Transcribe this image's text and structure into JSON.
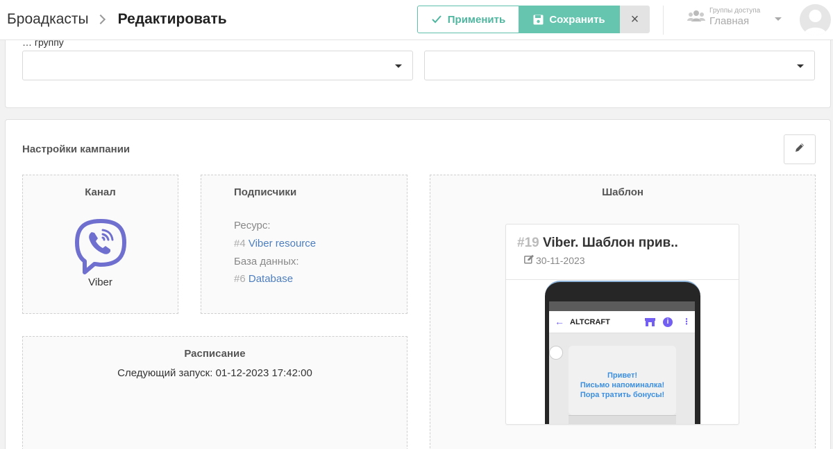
{
  "header": {
    "breadcrumb_parent": "Броадкасты",
    "breadcrumb_current": "Редактировать",
    "apply_label": "Применить",
    "save_label": "Сохранить",
    "close_label": "×",
    "access_caption": "Группы доступа",
    "access_value": "Главная"
  },
  "top_card": {
    "partial_label": "… группу"
  },
  "campaign": {
    "title": "Настройки кампании",
    "channel": {
      "title": "Канал",
      "name": "Viber"
    },
    "subscribers": {
      "title": "Подписчики",
      "resource_label": "Ресурс:",
      "resource_num": "#4",
      "resource_name": "Viber resource",
      "database_label": "База данных:",
      "database_num": "#6",
      "database_name": "Database"
    },
    "schedule": {
      "title": "Расписание",
      "next_run": "Следующий запуск: 01-12-2023 17:42:00"
    },
    "template": {
      "title": "Шаблон",
      "num": "#19",
      "name": "Viber. Шаблон прив..",
      "date": "30-11-2023",
      "preview": {
        "sender": "ALTCRAFT",
        "message_lines": [
          "Привет!",
          "Письмо напоминалка!",
          "Пора тратить бонусы!"
        ]
      }
    }
  },
  "colors": {
    "accent": "#66c5ae",
    "viber": "#6f6fcf",
    "link": "#4d7ebf"
  }
}
